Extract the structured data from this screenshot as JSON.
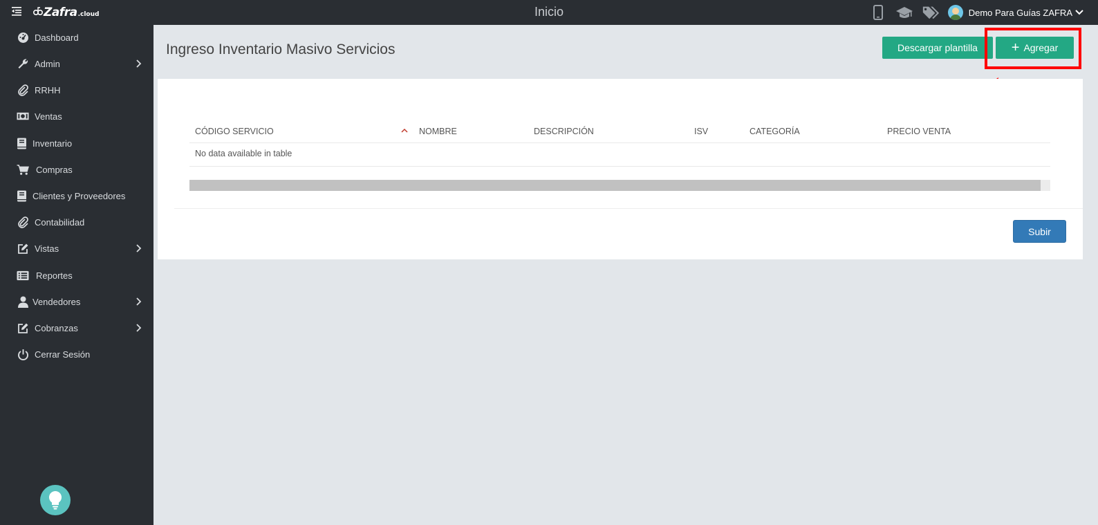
{
  "header": {
    "brand": "Zafra",
    "brand_suffix": ".cloud",
    "page_heading": "Inicio",
    "user_name": "Demo Para Guías ZAFRA",
    "icons": [
      "mobile-icon",
      "graduation-cap-icon",
      "tags-icon"
    ]
  },
  "sidebar": {
    "items": [
      {
        "label": "Dashboard",
        "icon": "dashboard-icon",
        "has_children": false
      },
      {
        "label": "Admin",
        "icon": "wrench-icon",
        "has_children": true
      },
      {
        "label": "RRHH",
        "icon": "paperclip-icon",
        "has_children": false
      },
      {
        "label": "Ventas",
        "icon": "money-icon",
        "has_children": false
      },
      {
        "label": "Inventario",
        "icon": "book-icon",
        "has_children": false
      },
      {
        "label": "Compras",
        "icon": "cart-icon",
        "has_children": false
      },
      {
        "label": "Clientes y Proveedores",
        "icon": "address-book-icon",
        "has_children": false
      },
      {
        "label": "Contabilidad",
        "icon": "paperclip-icon",
        "has_children": false
      },
      {
        "label": "Vistas",
        "icon": "edit-icon",
        "has_children": true
      },
      {
        "label": "Reportes",
        "icon": "list-icon",
        "has_children": false
      },
      {
        "label": "Vendedores",
        "icon": "user-icon",
        "has_children": true
      },
      {
        "label": "Cobranzas",
        "icon": "edit-icon",
        "has_children": true
      },
      {
        "label": "Cerrar Sesión",
        "icon": "power-icon",
        "has_children": false
      }
    ]
  },
  "main": {
    "title": "Ingreso Inventario Masivo Servicios",
    "download_label": "Descargar plantilla",
    "add_label": "Agregar",
    "table": {
      "columns": [
        "CÓDIGO SERVICIO",
        "NOMBRE",
        "DESCRIPCIÓN",
        "ISV",
        "CATEGORÍA",
        "PRECIO VENTA"
      ],
      "sorted_column": "CÓDIGO SERVICIO",
      "sort_direction": "ascending",
      "empty_message": "No data available in table"
    },
    "upload_label": "Subir"
  },
  "colors": {
    "topbar": "#2a2e33",
    "sidebar": "#2a2e33",
    "background": "#e2e6ea",
    "primary_green": "#23a884",
    "upload_blue": "#337ab7",
    "annotation_red": "#ff0000",
    "help_teal": "#5bc3c0"
  }
}
